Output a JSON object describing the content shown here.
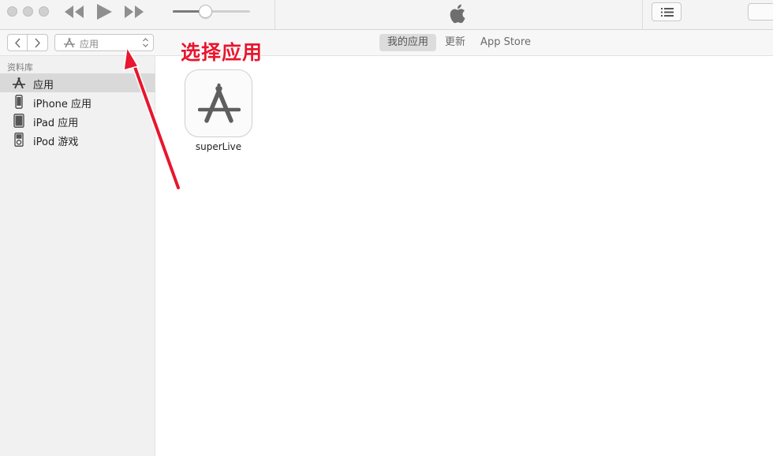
{
  "toolbar": {
    "icons": {
      "close": "traffic-light-close",
      "minimize": "traffic-light-minimize",
      "zoom": "traffic-light-zoom",
      "previous": "rewind-icon",
      "play": "play-icon",
      "next": "fast-forward-icon",
      "apple": "apple-logo",
      "list": "list-icon"
    },
    "volume_level": 0.42
  },
  "navbar": {
    "media_kind_label": "应用",
    "tabs": [
      {
        "label": "我的应用",
        "active": true
      },
      {
        "label": "更新",
        "active": false
      },
      {
        "label": "App Store",
        "active": false
      }
    ]
  },
  "sidebar": {
    "header": "资料库",
    "items": [
      {
        "label": "应用",
        "icon": "app-store-icon",
        "selected": true
      },
      {
        "label": "iPhone 应用",
        "icon": "iphone-icon",
        "selected": false
      },
      {
        "label": "iPad 应用",
        "icon": "ipad-icon",
        "selected": false
      },
      {
        "label": "iPod 游戏",
        "icon": "ipod-icon",
        "selected": false
      }
    ]
  },
  "main": {
    "apps": [
      {
        "name": "superLive",
        "icon": "app-store-icon"
      }
    ]
  },
  "annotation": {
    "text": "选择应用",
    "color": "#e8162e"
  },
  "colors": {
    "accent_red": "#e8162e",
    "sidebar_bg": "#f1f1f1",
    "selected_row": "#d9d9d9"
  }
}
